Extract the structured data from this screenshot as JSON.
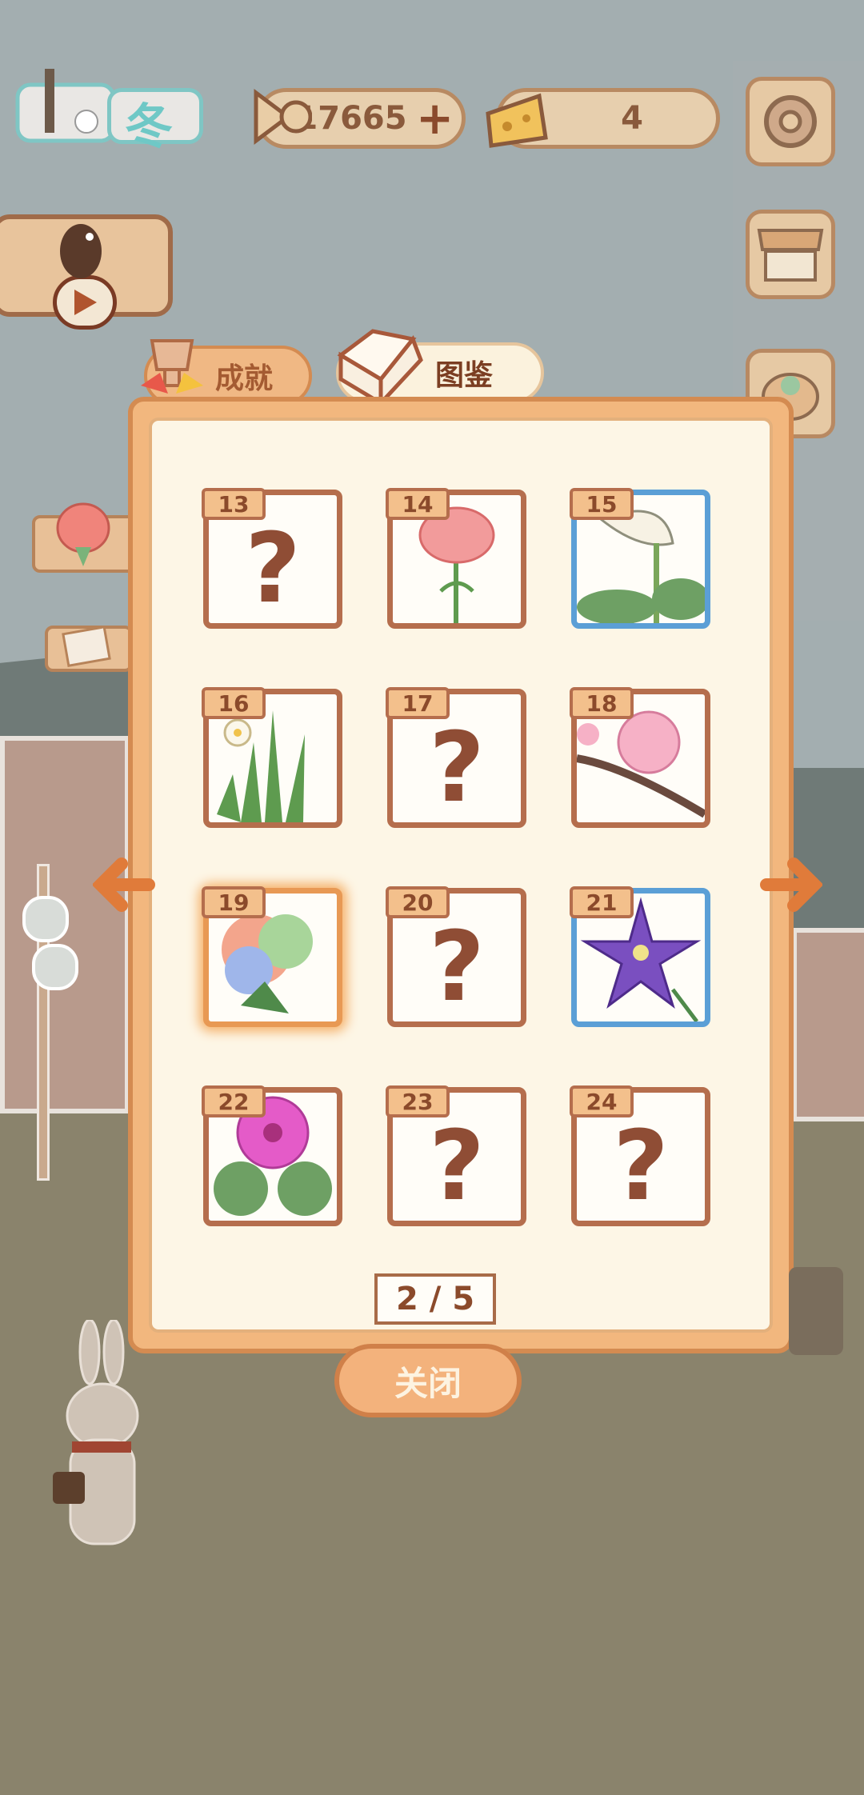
{
  "season": {
    "label": "冬"
  },
  "currency": {
    "fish": "17665",
    "plus": "+",
    "cheese": "4"
  },
  "icons": {
    "gear": "gear-icon",
    "shop": "shop-icon",
    "basket": "basket-icon",
    "fishbone": "fishbone-icon",
    "cheese": "cheese-icon",
    "play": "play-icon",
    "trophy": "trophy-icon",
    "book": "book-icon"
  },
  "tabs": {
    "achievements": "成就",
    "collection": "图鉴"
  },
  "cards": [
    {
      "num": "13",
      "state": "locked",
      "q": "?"
    },
    {
      "num": "14",
      "state": "carnation"
    },
    {
      "num": "15",
      "state": "calla"
    },
    {
      "num": "16",
      "state": "narcissus"
    },
    {
      "num": "17",
      "state": "locked",
      "q": "?"
    },
    {
      "num": "18",
      "state": "plum"
    },
    {
      "num": "19",
      "state": "rose"
    },
    {
      "num": "20",
      "state": "locked",
      "q": "?"
    },
    {
      "num": "21",
      "state": "clematis"
    },
    {
      "num": "22",
      "state": "gerbera"
    },
    {
      "num": "23",
      "state": "locked",
      "q": "?"
    },
    {
      "num": "24",
      "state": "locked",
      "q": "?"
    }
  ],
  "pager": "2 / 5",
  "close_label": "关闭",
  "colors": {
    "frame": "#b56e4d",
    "rare": "#5b9fd6",
    "accent": "#f2b77e"
  }
}
